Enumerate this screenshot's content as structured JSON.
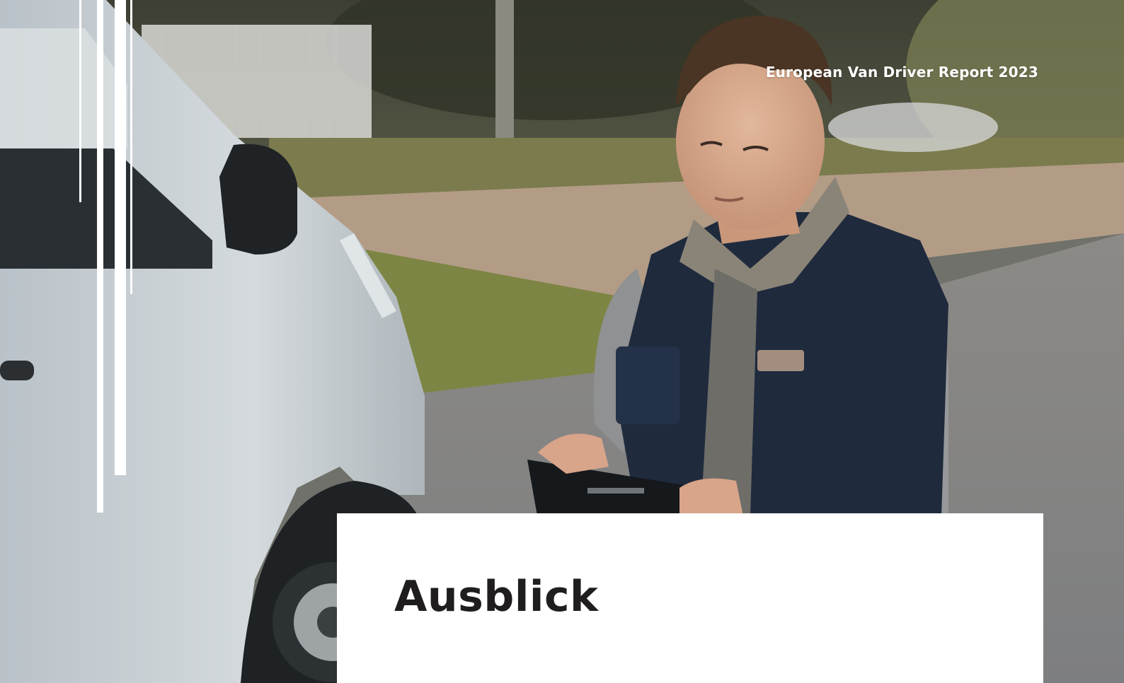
{
  "document": {
    "report_title": "European Van Driver Report 2023",
    "headline": "Ausblick"
  },
  "colors": {
    "text_dark": "#1f1d1e",
    "accent_white": "#ffffff"
  }
}
